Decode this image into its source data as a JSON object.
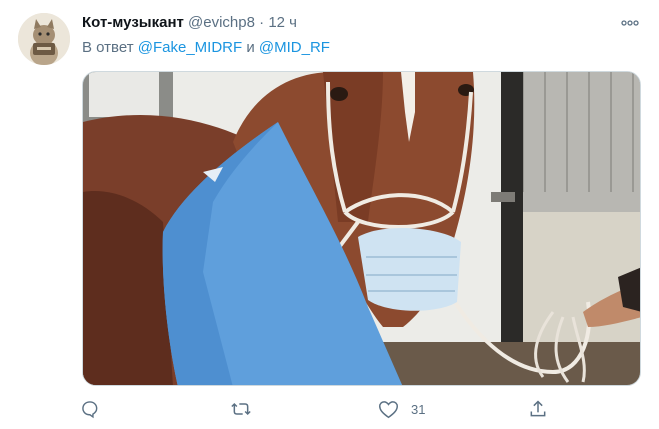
{
  "tweet": {
    "author_name": "Кот-музыкант",
    "author_handle": "@evichp8",
    "separator": "·",
    "time": "12 ч",
    "reply_prefix": "В ответ",
    "mentions": [
      "@Fake_MIDRF",
      "@MID_RF"
    ],
    "mention_joiner": "и"
  },
  "actions": {
    "reply_icon": "reply-icon",
    "retweet_icon": "retweet-icon",
    "like_icon": "like-icon",
    "like_count": "31",
    "share_icon": "share-icon"
  },
  "colors": {
    "text": "#0f1419",
    "secondary": "#5b7083",
    "link": "#1b95e0"
  }
}
